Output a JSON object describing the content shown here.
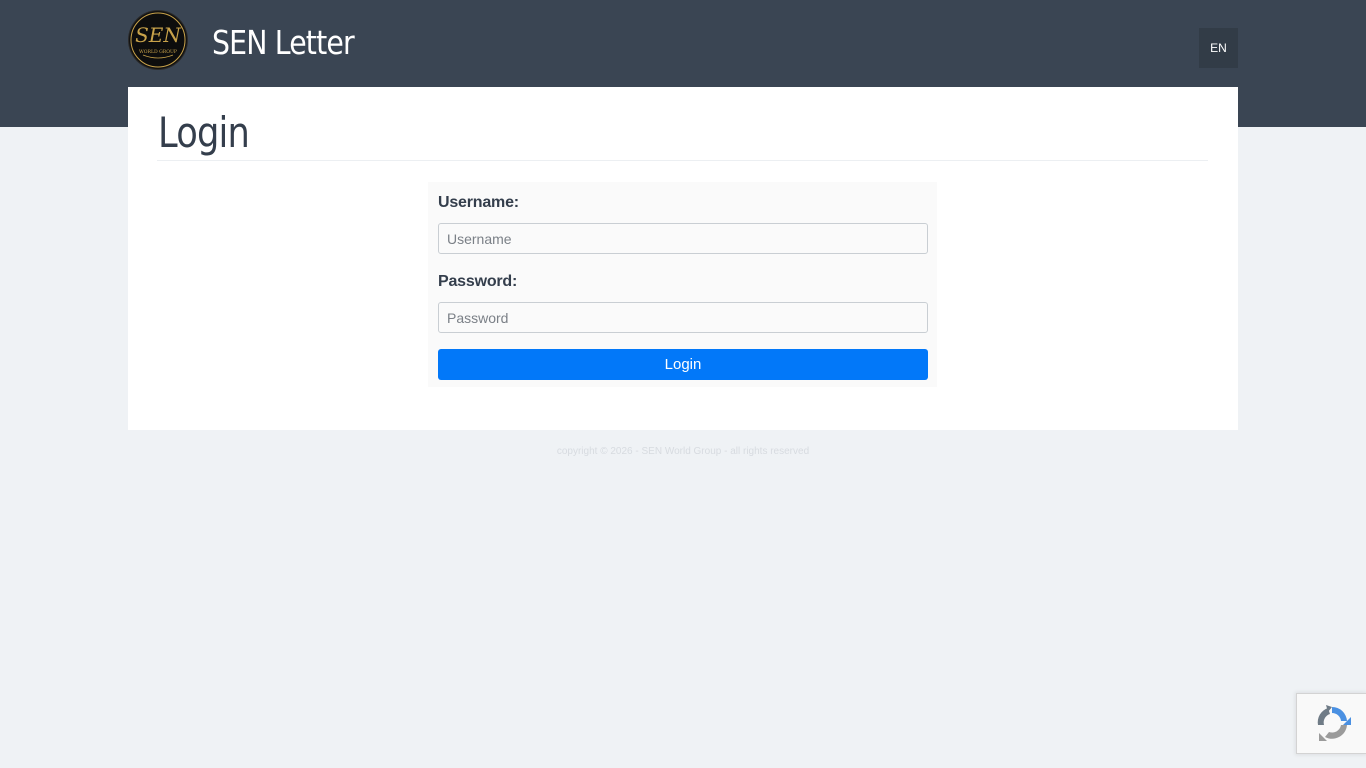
{
  "header": {
    "logo_text": "SEN",
    "logo_subtext": "WORLD GROUP",
    "brand": "SEN Letter",
    "language": "EN"
  },
  "page": {
    "title": "Login"
  },
  "form": {
    "username_label": "Username:",
    "username_placeholder": "Username",
    "password_label": "Password:",
    "password_placeholder": "Password",
    "submit_label": "Login"
  },
  "footer": {
    "text": "copyright © 2026 - SEN World Group - all rights reserved"
  },
  "colors": {
    "header_bg": "#3a4553",
    "page_bg": "#eff2f5",
    "primary_button": "#0278f9",
    "logo_gold": "#c8a24a"
  },
  "icons": {
    "recaptcha": "recaptcha-icon"
  }
}
